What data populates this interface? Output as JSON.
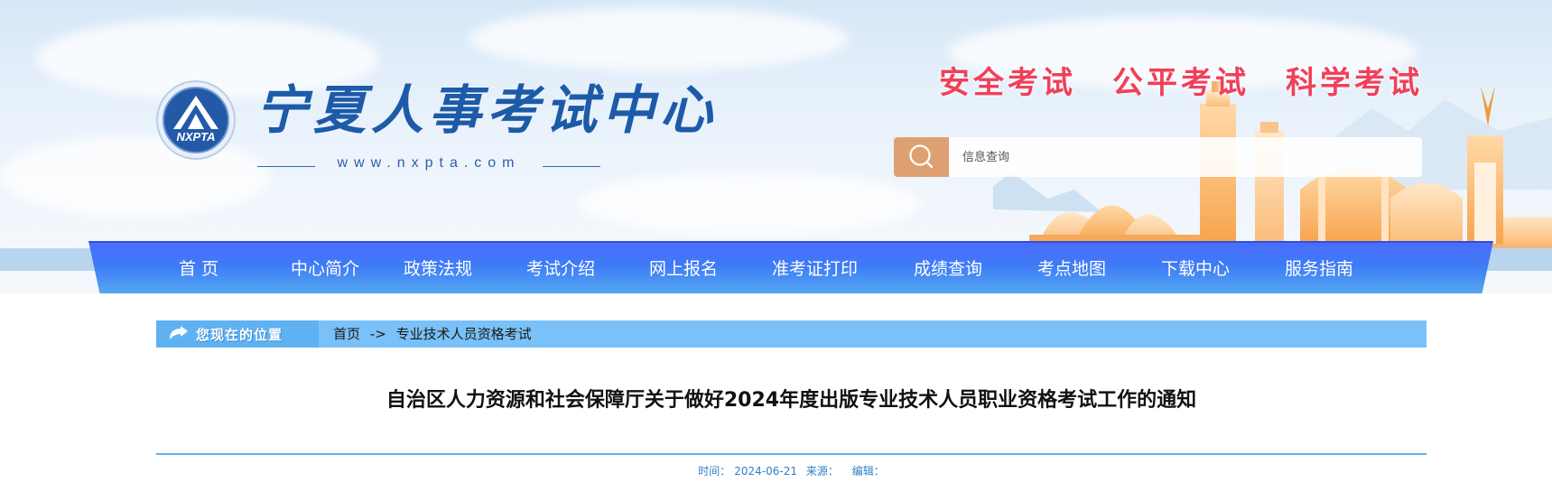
{
  "header": {
    "site_name": "宁夏人事考试中心",
    "logo_badge_text": "NXPTA",
    "site_url": "www.nxpta.com",
    "slogans": [
      "安全考试",
      "公平考试",
      "科学考试"
    ],
    "search": {
      "placeholder": "信息查询",
      "icon": "search-icon"
    }
  },
  "nav": {
    "items": [
      {
        "label": "首  页"
      },
      {
        "label": "中心简介"
      },
      {
        "label": "政策法规"
      },
      {
        "label": "考试介绍"
      },
      {
        "label": "网上报名"
      },
      {
        "label": "准考证打印"
      },
      {
        "label": "成绩查询"
      },
      {
        "label": "考点地图"
      },
      {
        "label": "下载中心"
      },
      {
        "label": "服务指南"
      }
    ]
  },
  "breadcrumb": {
    "badge_label": "您现在的位置",
    "home": "首页",
    "separator": "->",
    "current": "专业技术人员资格考试"
  },
  "article": {
    "title": "自治区人力资源和社会保障厅关于做好2024年度出版专业技术人员职业资格考试工作的通知",
    "meta": {
      "time_label": "时间：",
      "time": "2024-06-21",
      "source_label": "来源：",
      "editor_label": "编辑："
    }
  },
  "colors": {
    "nav_blue": "#3e7bf6",
    "breadcrumb_blue": "#79c1f8",
    "slogan_red": "#f0405a",
    "search_button": "#dfa071",
    "meta_text": "#2f7ec6"
  }
}
